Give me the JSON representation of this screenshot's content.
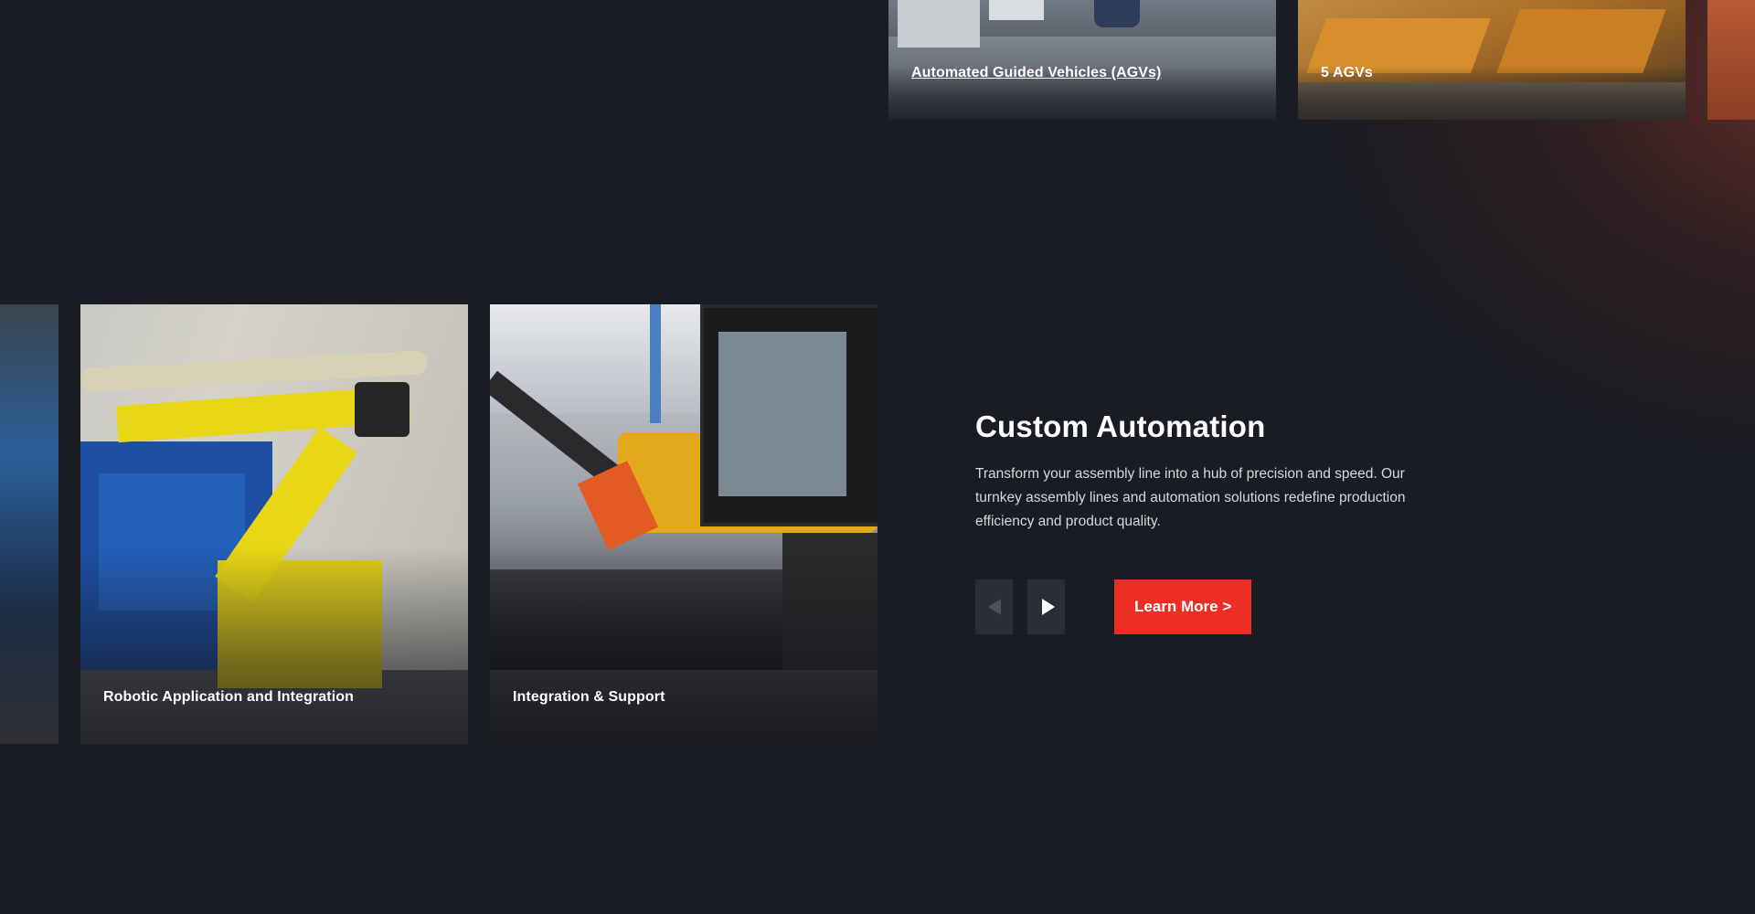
{
  "top_cards": [
    {
      "title": "Automated Guided Vehicles (AGVs)"
    },
    {
      "title": "5 AGVs"
    }
  ],
  "bottom_cards": [
    {
      "title": "Robotic Application and Integration"
    },
    {
      "title": "Integration & Support"
    }
  ],
  "section": {
    "heading": "Custom Automation",
    "description": "Transform your assembly line into a hub of precision and speed. Our turnkey assembly lines and automation solutions redefine production efficiency and product quality."
  },
  "controls": {
    "prev_icon": "chevron-left-icon",
    "next_icon": "chevron-right-icon",
    "learn_more_label": "Learn More >"
  },
  "colors": {
    "background": "#191c23",
    "accent": "#ee2e24",
    "nav_button": "#2a2e36"
  }
}
